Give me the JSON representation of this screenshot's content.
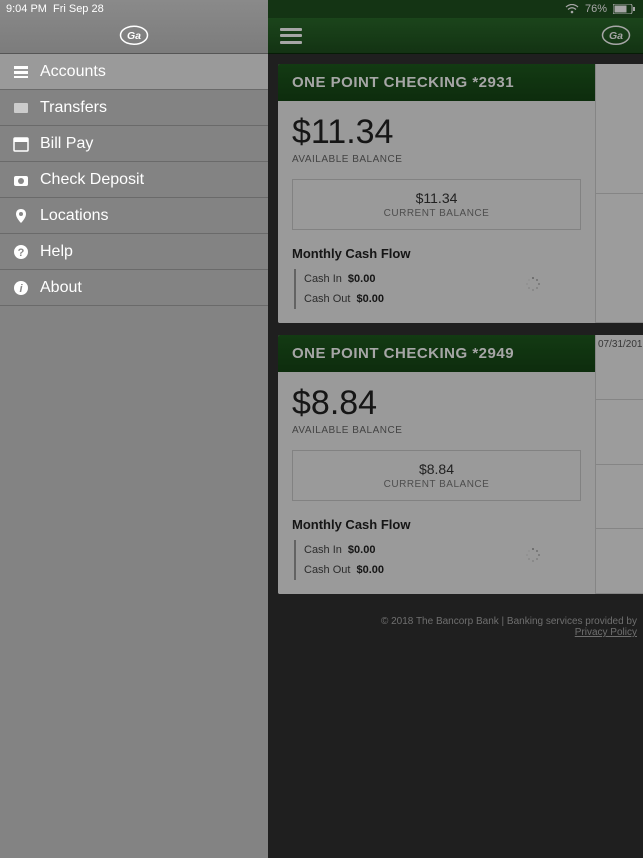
{
  "status": {
    "time": "9:04 PM",
    "date": "Fri Sep 28",
    "battery": "76%"
  },
  "sidebar": {
    "items": [
      {
        "label": "Accounts",
        "icon": "accounts"
      },
      {
        "label": "Transfers",
        "icon": "transfers"
      },
      {
        "label": "Bill Pay",
        "icon": "billpay"
      },
      {
        "label": "Check Deposit",
        "icon": "camera"
      },
      {
        "label": "Locations",
        "icon": "pin"
      },
      {
        "label": "Help",
        "icon": "help"
      },
      {
        "label": "About",
        "icon": "info"
      }
    ]
  },
  "accounts": [
    {
      "title": "ONE POINT CHECKING *2931",
      "available_balance": "$11.34",
      "available_label": "AVAILABLE BALANCE",
      "current_balance": "$11.34",
      "current_label": "CURRENT BALANCE",
      "cashflow_title": "Monthly Cash Flow",
      "cash_in_label": "Cash In",
      "cash_in": "$0.00",
      "cash_out_label": "Cash Out",
      "cash_out": "$0.00",
      "right_date": ""
    },
    {
      "title": "ONE POINT CHECKING *2949",
      "available_balance": "$8.84",
      "available_label": "AVAILABLE BALANCE",
      "current_balance": "$8.84",
      "current_label": "CURRENT BALANCE",
      "cashflow_title": "Monthly Cash Flow",
      "cash_in_label": "Cash In",
      "cash_in": "$0.00",
      "cash_out_label": "Cash Out",
      "cash_out": "$0.00",
      "right_date": "07/31/201"
    }
  ],
  "footer": {
    "copyright": "© 2018 The Bancorp Bank | Banking services provided by",
    "privacy": "Privacy Policy"
  }
}
